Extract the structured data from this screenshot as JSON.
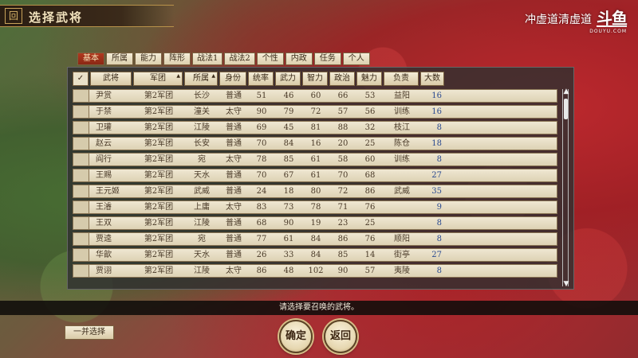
{
  "header": {
    "emblem": "回",
    "title": "选择武将"
  },
  "stream": {
    "caption": "冲虚道清虚道",
    "brand": "斗鱼",
    "sub": "DOUYU.COM"
  },
  "tabs": [
    {
      "label": "基本",
      "active": true
    },
    {
      "label": "所属",
      "active": false
    },
    {
      "label": "能力",
      "active": false
    },
    {
      "label": "阵形",
      "active": false
    },
    {
      "label": "战法1",
      "active": false
    },
    {
      "label": "战法2",
      "active": false
    },
    {
      "label": "个性",
      "active": false
    },
    {
      "label": "内政",
      "active": false
    },
    {
      "label": "任务",
      "active": false
    },
    {
      "label": "个人",
      "active": false
    }
  ],
  "columns": [
    "武将",
    "军团",
    "所属",
    "身份",
    "统率",
    "武力",
    "智力",
    "政治",
    "魅力",
    "负责",
    "大数"
  ],
  "check_mark": "✓",
  "rows": [
    [
      "尹赏",
      "第2军团",
      "长沙",
      "普通",
      "51",
      "46",
      "60",
      "66",
      "53",
      "益阳",
      "16"
    ],
    [
      "于禁",
      "第2军团",
      "潼关",
      "太守",
      "90",
      "79",
      "72",
      "57",
      "56",
      "训练",
      "16"
    ],
    [
      "卫瓘",
      "第2军团",
      "江陵",
      "普通",
      "69",
      "45",
      "81",
      "88",
      "32",
      "枝江",
      "8"
    ],
    [
      "赵云",
      "第2军团",
      "长安",
      "普通",
      "70",
      "84",
      "16",
      "20",
      "25",
      "陈仓",
      "18"
    ],
    [
      "阎行",
      "第2军团",
      "宛",
      "太守",
      "78",
      "85",
      "61",
      "58",
      "60",
      "训练",
      "8"
    ],
    [
      "王赐",
      "第2军团",
      "天水",
      "普通",
      "70",
      "67",
      "61",
      "70",
      "68",
      "",
      "27"
    ],
    [
      "王元姬",
      "第2军团",
      "武威",
      "普通",
      "24",
      "18",
      "80",
      "72",
      "86",
      "武威",
      "35"
    ],
    [
      "王濬",
      "第2军团",
      "上庸",
      "太守",
      "83",
      "73",
      "78",
      "71",
      "76",
      "",
      "9"
    ],
    [
      "王双",
      "第2军团",
      "江陵",
      "普通",
      "68",
      "90",
      "19",
      "23",
      "25",
      "",
      "8"
    ],
    [
      "贾逵",
      "第2军团",
      "宛",
      "普通",
      "77",
      "61",
      "84",
      "86",
      "76",
      "顺阳",
      "8"
    ],
    [
      "华歆",
      "第2军团",
      "天水",
      "普通",
      "26",
      "33",
      "84",
      "85",
      "14",
      "街亭",
      "27"
    ],
    [
      "贾诩",
      "第2军团",
      "江陵",
      "太守",
      "86",
      "48",
      "102",
      "90",
      "57",
      "夷陵",
      "8"
    ]
  ],
  "scroll": {
    "up": "▲",
    "down": "▼"
  },
  "message": "请选择要召唤的武将。",
  "buttons": {
    "select_all": "一并选择",
    "confirm": "确定",
    "back": "返回"
  }
}
